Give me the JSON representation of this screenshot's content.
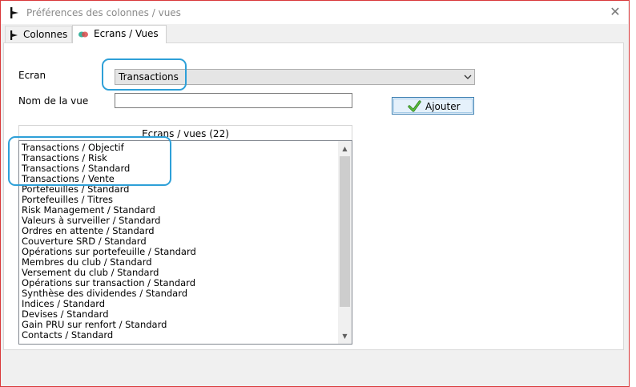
{
  "window": {
    "title": "Préférences des colonnes / vues",
    "close_glyph": "✕"
  },
  "tabs": [
    {
      "label": "Colonnes",
      "icon": "column-marker-icon",
      "active": false
    },
    {
      "label": "Ecrans / Vues",
      "icon": "screens-icon",
      "active": true
    }
  ],
  "form": {
    "ecran_label": "Ecran",
    "ecran_value": "Transactions",
    "nom_vue_label": "Nom de la vue",
    "nom_vue_value": "",
    "add_button_label": "Ajouter"
  },
  "views_list": {
    "header": "Ecrans / vues (22)",
    "items": [
      "Transactions / Objectif",
      "Transactions / Risk",
      "Transactions / Standard",
      "Transactions / Vente",
      "Portefeuilles / Standard",
      "Portefeuilles / Titres",
      "Risk Management / Standard",
      "Valeurs à surveiller / Standard",
      "Ordres en attente / Standard",
      "Couverture SRD / Standard",
      "Opérations sur portefeuille / Standard",
      "Membres du club / Standard",
      "Versement du club / Standard",
      "Opérations sur transaction / Standard",
      "Synthèse des dividendes / Standard",
      "Indices / Standard",
      "Devises / Standard",
      "Gain PRU sur renfort / Standard",
      "Contacts / Standard"
    ]
  },
  "colors": {
    "highlight": "#2ea0d8",
    "accent_button_border": "#3c7fb1",
    "window_border": "#d9383a"
  }
}
